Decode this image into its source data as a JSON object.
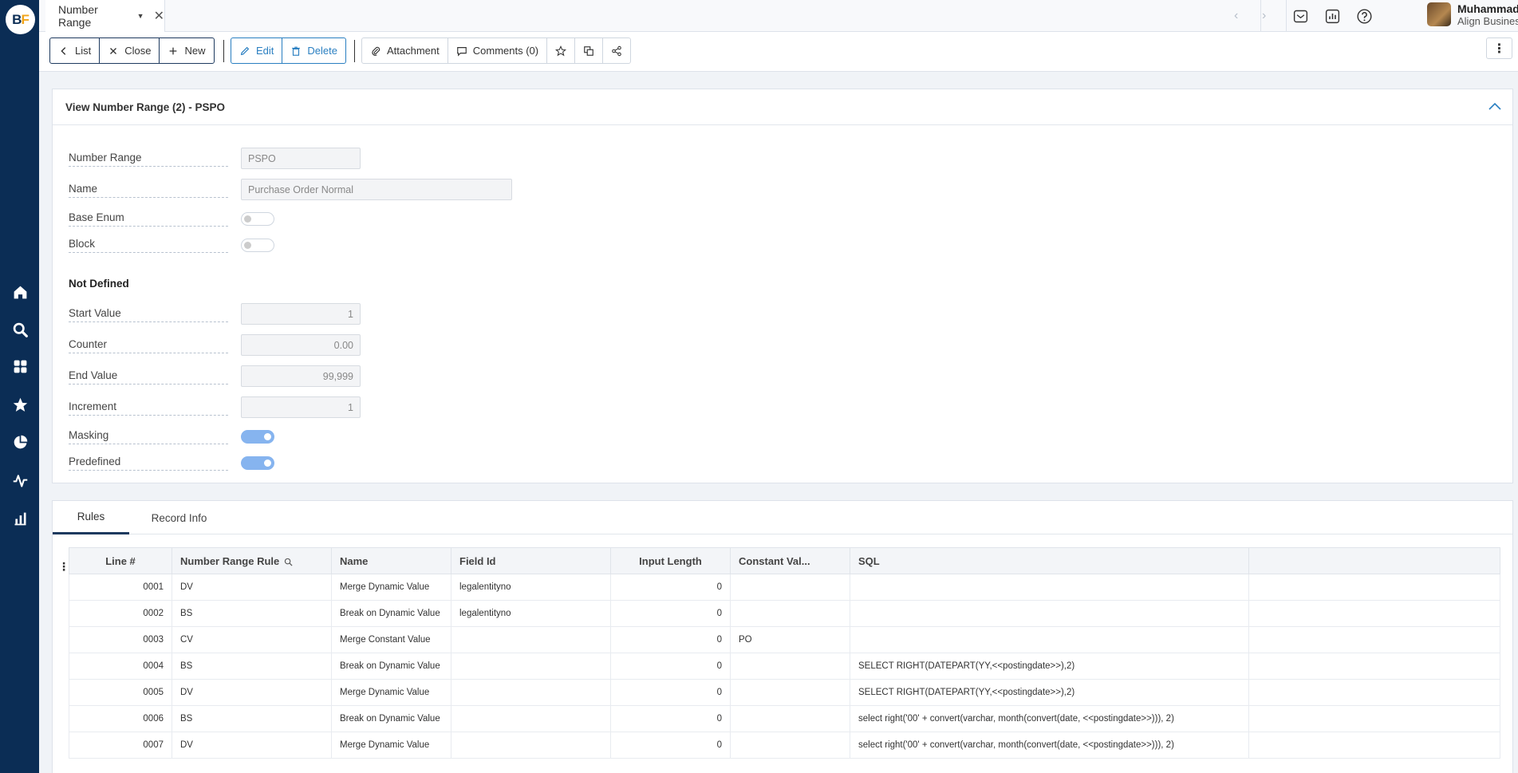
{
  "sidebar": {
    "logo": {
      "b": "B",
      "f": "F"
    },
    "icons": [
      "home-icon",
      "search-icon",
      "apps-grid-icon",
      "star-icon",
      "pie-chart-icon",
      "activity-icon",
      "bar-chart-icon"
    ]
  },
  "topbar": {
    "tab_title": "Number Range",
    "user_name": "Muhammad Sadiq",
    "user_org": "Align Business Systems"
  },
  "toolbar": {
    "list": "List",
    "close": "Close",
    "new": "New",
    "edit": "Edit",
    "delete": "Delete",
    "attachment": "Attachment",
    "comments": "Comments (0)"
  },
  "form": {
    "header": "View Number Range (2) - PSPO",
    "number_range_label": "Number Range",
    "number_range_value": "PSPO",
    "name_label": "Name",
    "name_value": "Purchase Order Normal",
    "base_enum_label": "Base Enum",
    "base_enum_on": false,
    "block_label": "Block",
    "block_on": false,
    "section_title": "Not Defined",
    "start_value_label": "Start Value",
    "start_value": "1",
    "counter_label": "Counter",
    "counter_value": "0.00",
    "end_value_label": "End Value",
    "end_value": "99,999",
    "increment_label": "Increment",
    "increment_value": "1",
    "masking_label": "Masking",
    "masking_on": true,
    "predefined_label": "Predefined",
    "predefined_on": true
  },
  "tabs": {
    "rules": "Rules",
    "record_info": "Record Info"
  },
  "grid": {
    "columns": [
      "Line #",
      "Number Range Rule",
      "Name",
      "Field Id",
      "Input Length",
      "Constant Val...",
      "SQL"
    ],
    "rows": [
      [
        "0001",
        "DV",
        "Merge Dynamic Value",
        "legalentityno",
        "0",
        "",
        ""
      ],
      [
        "0002",
        "BS",
        "Break on Dynamic Value",
        "legalentityno",
        "0",
        "",
        ""
      ],
      [
        "0003",
        "CV",
        "Merge Constant Value",
        "",
        "0",
        "PO",
        ""
      ],
      [
        "0004",
        "BS",
        "Break on Dynamic Value",
        "",
        "0",
        "",
        "SELECT RIGHT(DATEPART(YY,<<postingdate>>),2)"
      ],
      [
        "0005",
        "DV",
        "Merge Dynamic Value",
        "",
        "0",
        "",
        "SELECT RIGHT(DATEPART(YY,<<postingdate>>),2)"
      ],
      [
        "0006",
        "BS",
        "Break on Dynamic Value",
        "",
        "0",
        "",
        "select right('00' + convert(varchar, month(convert(date, <<postingdate>>))), 2)"
      ],
      [
        "0007",
        "DV",
        "Merge Dynamic Value",
        "",
        "0",
        "",
        "select right('00' + convert(varchar, month(convert(date, <<postingdate>>))), 2)"
      ]
    ]
  }
}
